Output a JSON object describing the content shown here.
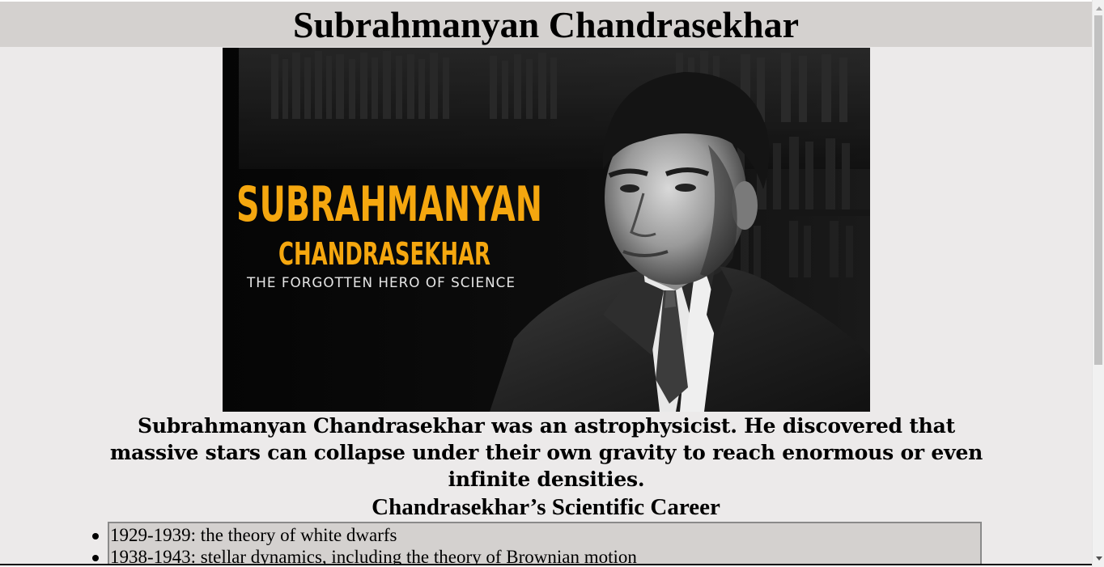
{
  "page": {
    "title": "Subrahmanyan Chandrasekhar"
  },
  "hero_image": {
    "alt": "Subrahmanyan Chandrasekhar portrait",
    "overlay_line1": "SUBRAHMANYAN",
    "overlay_line2": "CHANDRASEKHAR",
    "overlay_line3": "THE FORGOTTEN HERO OF SCIENCE",
    "accent_color": "#f5a70f"
  },
  "intro": {
    "text": "Subrahmanyan Chandrasekhar was an astrophysicist. He discovered that massive stars can collapse under their own gravity to reach enormous or even infinite densities."
  },
  "career": {
    "heading": "Chandrasekhar’s Scientific Career",
    "items": [
      {
        "text": "1929-1939: the theory of white dwarfs"
      },
      {
        "text": "1938-1943: stellar dynamics, including the theory of Brownian motion"
      }
    ]
  },
  "colors": {
    "page_background": "#eceaea",
    "title_bar_background": "#d4d1cf",
    "list_box_background": "#d4d1cf",
    "list_box_border": "#8a8a8a"
  }
}
